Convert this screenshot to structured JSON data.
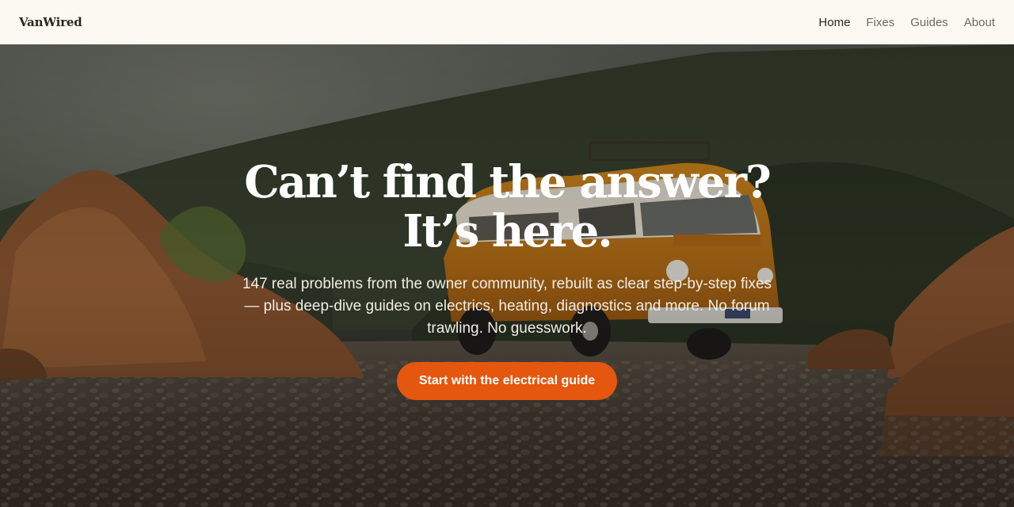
{
  "header": {
    "brand": "VanWired",
    "nav": [
      {
        "label": "Home",
        "active": true
      },
      {
        "label": "Fixes",
        "active": false
      },
      {
        "label": "Guides",
        "active": false
      },
      {
        "label": "About",
        "active": false
      }
    ]
  },
  "hero": {
    "headline": "Can’t find the answer? It’s here.",
    "subtitle": "147 real problems from the owner community, rebuilt as clear step-by-step fixes — plus deep-dive guides on electrics, heating, diagnostics and more. No forum trawling. No guesswork.",
    "cta_label": "Start with the electrical guide",
    "background": "orange camper van parked on a gravel track among rocks and forested hills"
  },
  "colors": {
    "header_bg": "#fcf9f2",
    "accent": "#e5560f",
    "headline_text": "#ffffff"
  }
}
